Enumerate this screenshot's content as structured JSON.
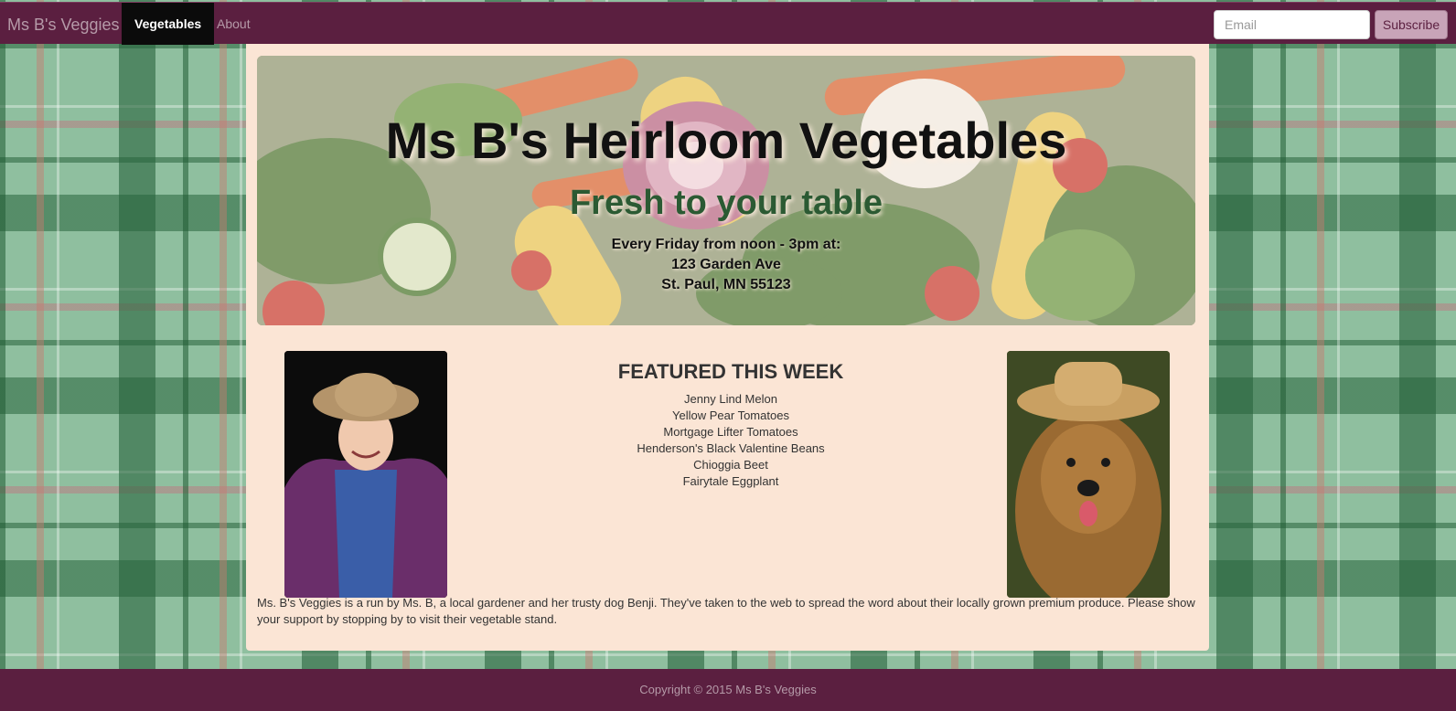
{
  "navbar": {
    "brand": "Ms B's Veggies",
    "items": [
      {
        "label": "Vegetables",
        "active": true
      },
      {
        "label": "About",
        "active": false
      }
    ],
    "email_placeholder": "Email",
    "subscribe_label": "Subscribe"
  },
  "hero": {
    "title": "Ms B's Heirloom Vegetables",
    "subtitle": "Fresh to your table",
    "schedule": "Every Friday from noon - 3pm at:",
    "address_line1": "123 Garden Ave",
    "address_line2": "St. Paul, MN 55123"
  },
  "featured": {
    "title": "FEATURED THIS WEEK",
    "items": [
      "Jenny Lind Melon",
      "Yellow Pear Tomatoes",
      "Mortgage Lifter Tomatoes",
      "Henderson's Black Valentine Beans",
      "Chioggia Beet",
      "Fairytale Eggplant"
    ]
  },
  "about": {
    "text": "Ms. B's Veggies is a run by Ms. B, a local gardener and her trusty dog Benji. They've taken to the web to spread the word about their locally grown premium produce. Please show your support by stopping by to visit their vegetable stand."
  },
  "footer": {
    "copyright": "Copyright © 2015 Ms B's Veggies"
  },
  "colors": {
    "nav_bg": "#5b1f40",
    "container_bg": "#fbe5d5",
    "subscribe_bg": "#c8a4b8",
    "subtitle_green": "#2b5a33"
  }
}
